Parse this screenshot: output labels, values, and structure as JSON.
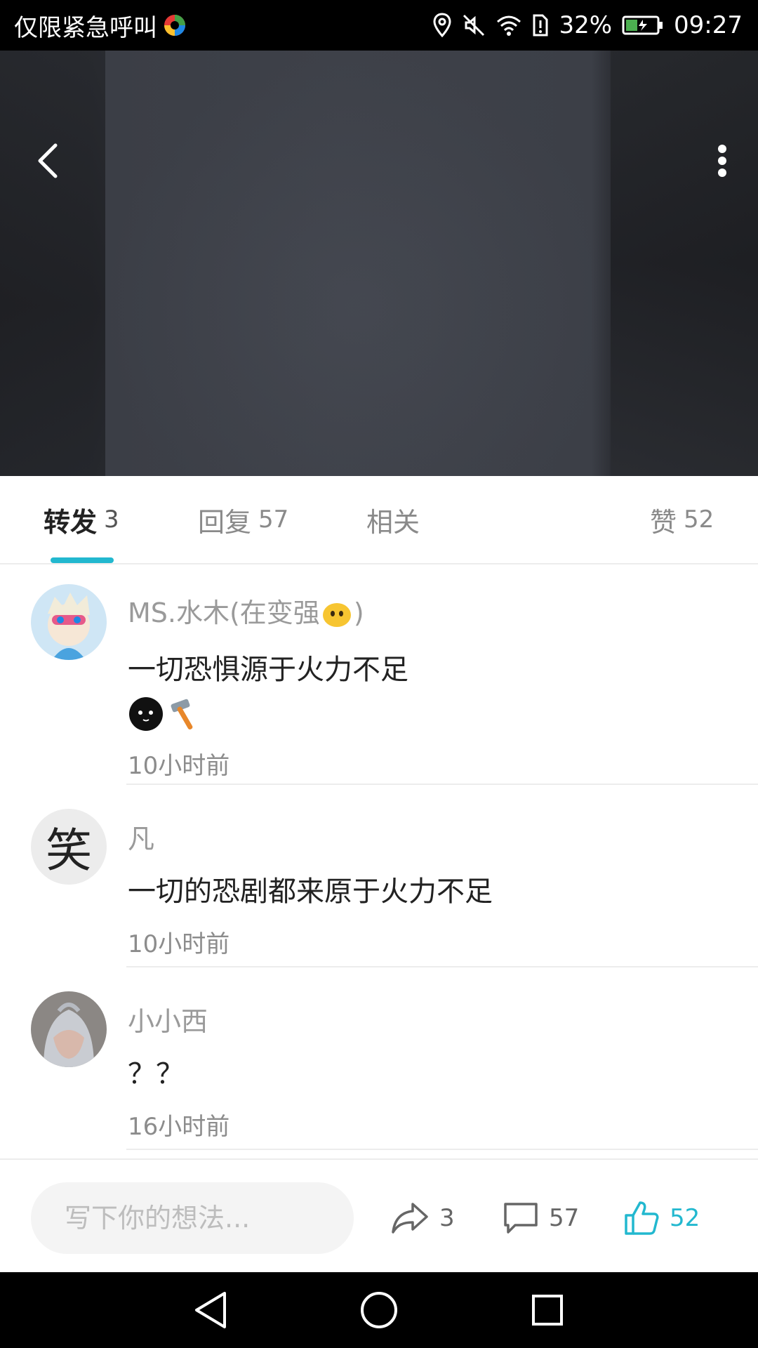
{
  "status_bar": {
    "carrier": "仅限紧急呼叫",
    "battery": "32%",
    "time": "09:27"
  },
  "header": {
    "back_icon": "chevron-left-icon",
    "more_icon": "more-vertical-icon"
  },
  "tabs": [
    {
      "label": "转发",
      "count": "3",
      "active": true
    },
    {
      "label": "回复",
      "count": "57",
      "active": false
    },
    {
      "label": "相关",
      "count": "",
      "active": false
    },
    {
      "label": "赞",
      "count": "52",
      "active": false
    }
  ],
  "comments": [
    {
      "name": "MS.水木(在变强",
      "name_suffix": ")",
      "text": "一切恐惧源于火力不足",
      "time": "10小时前"
    },
    {
      "name": "凡",
      "avatar_char": "笑",
      "text": "一切的恐剧都来原于火力不足",
      "time": "10小时前"
    },
    {
      "name": "小小西",
      "text": "？？",
      "time": "16小时前"
    }
  ],
  "bottom_bar": {
    "input_placeholder": "写下你的想法...",
    "share_count": "3",
    "comment_count": "57",
    "like_count": "52"
  },
  "colors": {
    "accent": "#22b8cf",
    "text_primary": "#222222",
    "text_secondary": "#9a9a9a"
  }
}
